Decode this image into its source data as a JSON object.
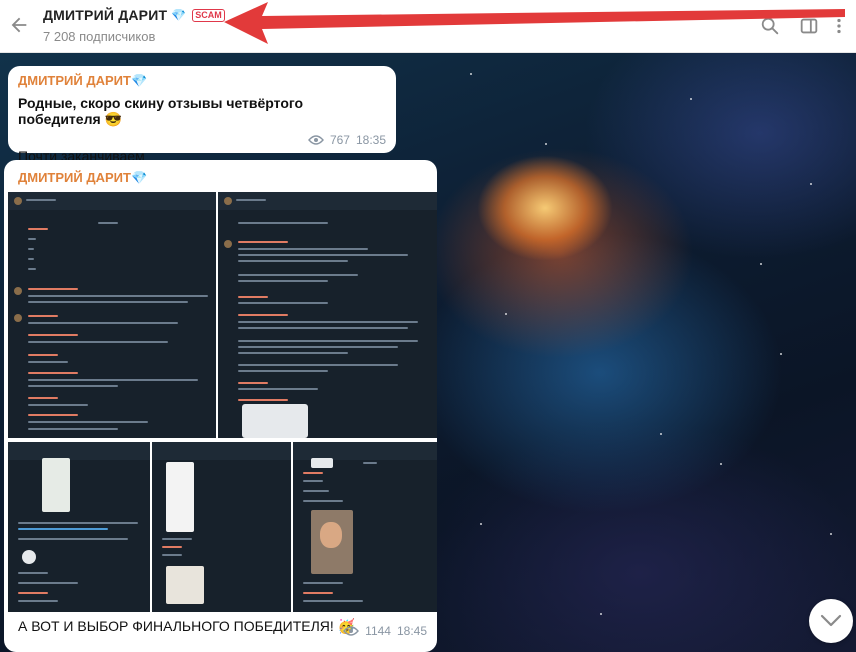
{
  "header": {
    "channel_name": "ДМИТРИЙ ДАРИТ",
    "scam_badge": "SCAM",
    "subscribers": "7 208 подписчиков",
    "icons": [
      "back-arrow-icon",
      "search-icon",
      "sidebar-toggle-icon",
      "more-vert-icon"
    ]
  },
  "messages": [
    {
      "sender": "ДМИТРИЙ ДАРИТ",
      "text_bold": "Родные, скоро скину отзывы четвёртого победителя 😎",
      "text": "Почти заканчиваем",
      "views": "767",
      "time": "18:35"
    },
    {
      "sender": "ДМИТРИЙ ДАРИТ",
      "caption": "А ВОТ И ВЫБОР ФИНАЛЬНОГО ПОБЕДИТЕЛЯ! 🥳",
      "views": "1144",
      "time": "18:45",
      "photo_count": 5
    }
  ],
  "colors": {
    "sender": "#e0823a",
    "scam": "#e0384a",
    "arrow": "#e23a3a",
    "meta": "#8a96a3"
  }
}
